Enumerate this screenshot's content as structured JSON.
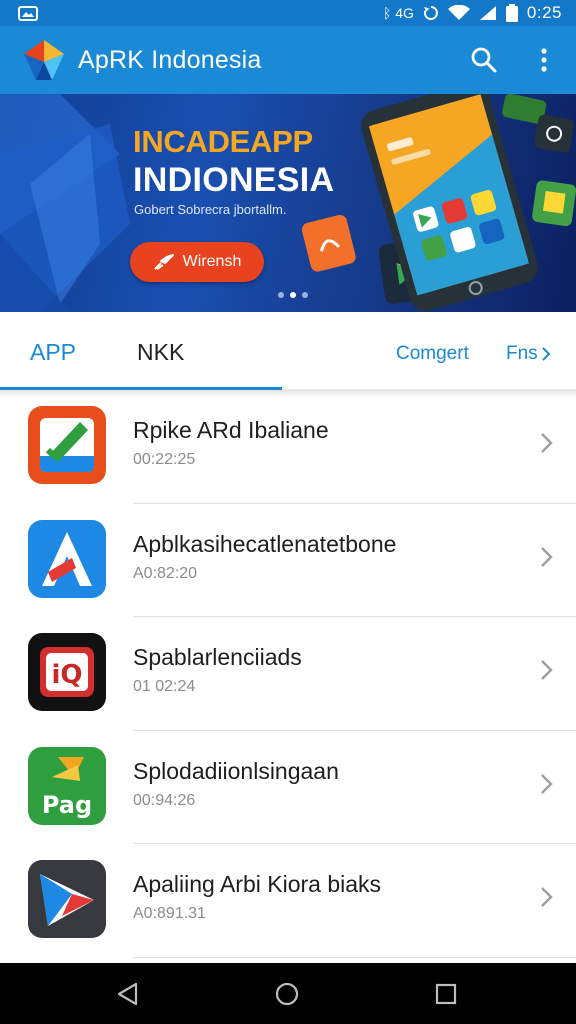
{
  "status_bar": {
    "indicators": "ᛒ 4G",
    "time": "0:25"
  },
  "app_bar": {
    "title": "ApRK Indonesia"
  },
  "banner": {
    "headline": "INCADEAPP",
    "headline2": "INDIONESIA",
    "subtitle": "Gobert Sobrecra jbortallm.",
    "cta_label": "Wirensh",
    "slide_count": 3,
    "active_slide": 2
  },
  "tabs": {
    "items": [
      "APP",
      "NKK"
    ],
    "links": [
      "Comgert",
      "Fns"
    ],
    "active": 0
  },
  "apps": [
    {
      "name": "Rpike ARd Ibaliane",
      "meta": "00:22:25",
      "icon": "green-check-document-icon"
    },
    {
      "name": "Apblkasihecatlenatetbone",
      "meta": "A0:82:20",
      "icon": "blue-letter-a-icon"
    },
    {
      "name": "Spablarlenciiads",
      "meta": "01 02:24",
      "icon": "red-iq-icon"
    },
    {
      "name": "Splodadiionlsingaan",
      "meta": "00:94:26",
      "icon": "green-pag-icon"
    },
    {
      "name": "Apaliing Arbi Kiora  biaks",
      "meta": "A0:891.31",
      "icon": "play-triangle-icon"
    }
  ],
  "colors": {
    "primary": "#1a8ad6",
    "status_bar": "#1478c8",
    "accent_orange": "#f5a623",
    "cta_red": "#e8421f"
  }
}
